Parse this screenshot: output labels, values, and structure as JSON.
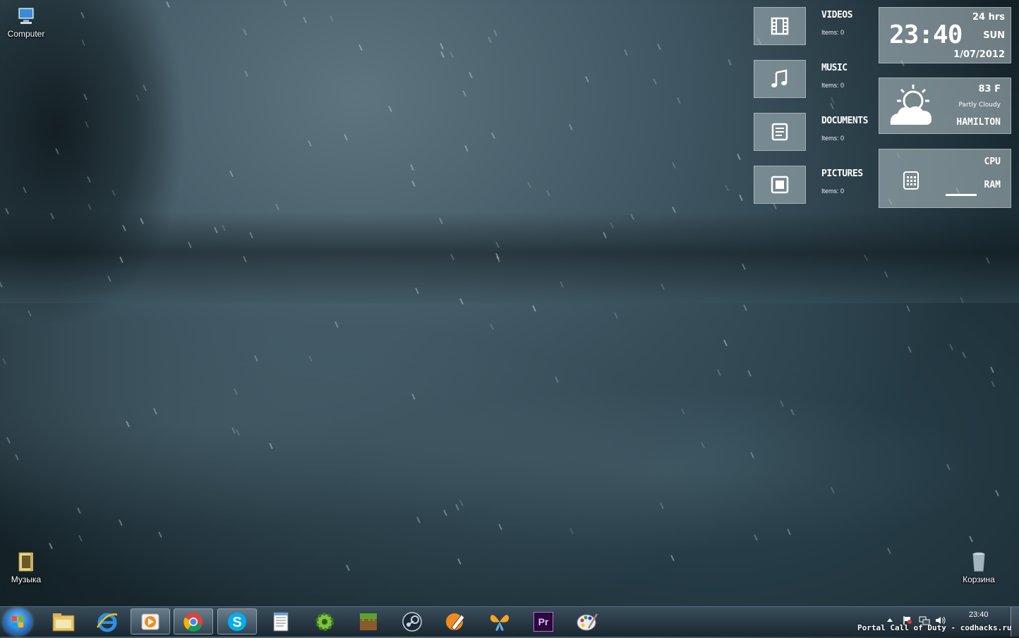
{
  "desktop": {
    "icons": [
      {
        "label": "Computer"
      },
      {
        "label": "Музыка"
      },
      {
        "label": "Корзина"
      }
    ]
  },
  "libraries": [
    {
      "title": "VIDEOS",
      "items": "Items: 0",
      "icon": "film-icon"
    },
    {
      "title": "MUSIC",
      "items": "Items: 0",
      "icon": "music-note-icon"
    },
    {
      "title": "DOCUMENTS",
      "items": "Items: 0",
      "icon": "document-icon"
    },
    {
      "title": "PICTURES",
      "items": "Items: 0",
      "icon": "picture-frame-icon"
    }
  ],
  "clock": {
    "format": "24 hrs",
    "time": "23:40",
    "day": "SUN",
    "date": "1/07/2012"
  },
  "weather": {
    "temp": "83 F",
    "condition": "Partly Cloudy",
    "city": "HAMILTON",
    "icon": "partly-cloudy-icon"
  },
  "system": {
    "cpu_label": "CPU",
    "ram_label": "RAM"
  },
  "taskbar": {
    "apps": [
      "windows-explorer-icon",
      "internet-explorer-icon",
      "media-player-icon",
      "chrome-icon",
      "skype-icon",
      "notepad-icon",
      "gear-app-icon",
      "minecraft-icon",
      "steam-icon",
      "pen-tool-icon",
      "butterfly-icon",
      "premiere-icon",
      "paint-palette-icon"
    ],
    "clock_time": "23:40",
    "premiere_label": "Pr"
  },
  "watermark": "Portal Call of Duty - codhacks.ru"
}
